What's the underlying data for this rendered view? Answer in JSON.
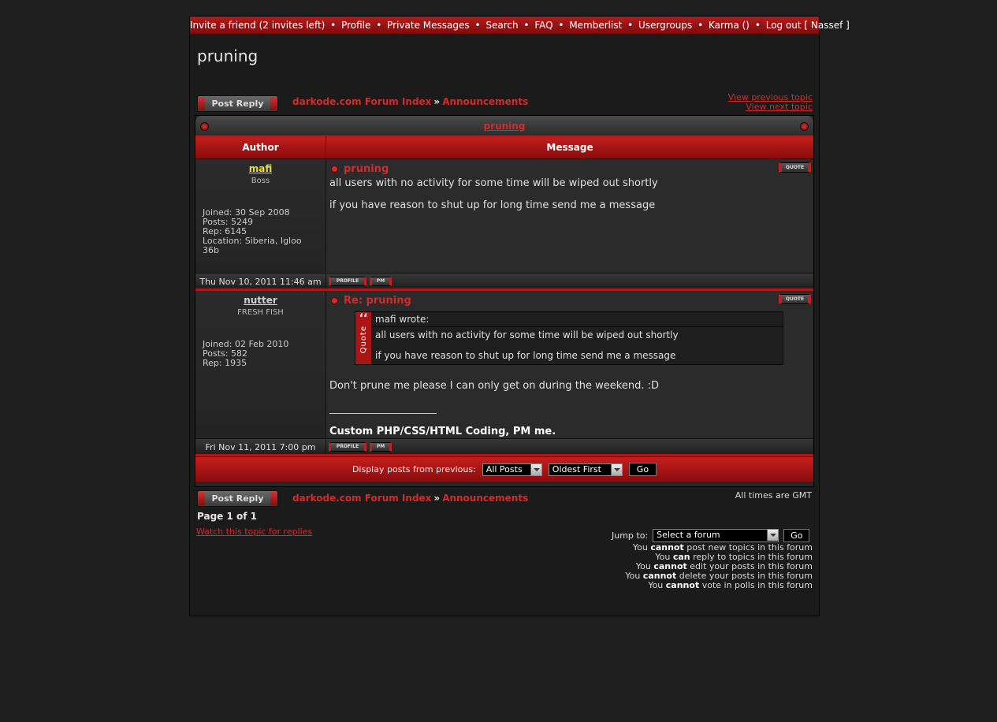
{
  "nav": {
    "invite": "Invite a friend (2 invites left)",
    "profile": "Profile",
    "pm": "Private Messages",
    "search": "Search",
    "faq": "FAQ",
    "memberlist": "Memberlist",
    "usergroups": "Usergroups",
    "karma": "Karma ()",
    "logout": "Log out [ Nassef ]",
    "sep": "•"
  },
  "page_title": "pruning",
  "post_reply_label": "Post Reply",
  "breadcrumb": {
    "index": "darkode.com Forum Index",
    "sep": "»",
    "forum": "Announcements"
  },
  "view_previous": "View previous topic",
  "view_next": "View next topic",
  "topic_title": "pruning",
  "headers": {
    "author": "Author",
    "message": "Message"
  },
  "quote_label": "QUOTE",
  "profile_label": "PROFILE",
  "pm_label": "PM",
  "posts": [
    {
      "username": "mafi",
      "username_color": "#e8e030",
      "rank": "Boss",
      "joined": "Joined: 30 Sep 2008",
      "posts": "Posts: 5249",
      "rep": "Rep: 6145",
      "location": "Location: Siberia, Igloo 36b",
      "title": "pruning",
      "body": [
        "all users with no activity for some time will be wiped out shortly",
        "if you have reason to shut up for long time send me a message"
      ],
      "date": "Thu Nov 10, 2011 11:46 am"
    },
    {
      "username": "nutter",
      "username_color": "#d0d0d0",
      "rank": "FRESH FISH",
      "joined": "Joined: 02 Feb 2010",
      "posts": "Posts: 582",
      "rep": "Rep: 1935",
      "title": "Re: pruning",
      "quote_author": "mafi wrote:",
      "quote_tab": "Quote",
      "quote_mark": "‘‘",
      "quote_lines": [
        "all users with no activity for some time will be wiped out shortly",
        "if you have reason to shut up for long time send me a message"
      ],
      "body": "Don't prune me please I can only get on during the weekend. :D",
      "signature": "Custom PHP/CSS/HTML Coding, PM me.",
      "date": "Fri Nov 11, 2011 7:00 pm"
    }
  ],
  "display": {
    "label": "Display posts from previous:",
    "range": "All Posts",
    "order": "Oldest First",
    "go": "Go"
  },
  "timezone": "All times are GMT",
  "pagination": "Page 1 of 1",
  "watch": "Watch this topic for replies",
  "jump": {
    "label": "Jump to:",
    "placeholder": "Select a forum",
    "go": "Go"
  },
  "permissions": [
    {
      "pre": "You ",
      "bold": "cannot",
      "post": " post new topics in this forum"
    },
    {
      "pre": "You ",
      "bold": "can",
      "post": " reply to topics in this forum"
    },
    {
      "pre": "You ",
      "bold": "cannot",
      "post": " edit your posts in this forum"
    },
    {
      "pre": "You ",
      "bold": "cannot",
      "post": " delete your posts in this forum"
    },
    {
      "pre": "You ",
      "bold": "cannot",
      "post": " vote in polls in this forum"
    }
  ],
  "colors": {
    "accent": "#d42a2a",
    "bar": "#a81616",
    "background": "#1e1e1e"
  }
}
